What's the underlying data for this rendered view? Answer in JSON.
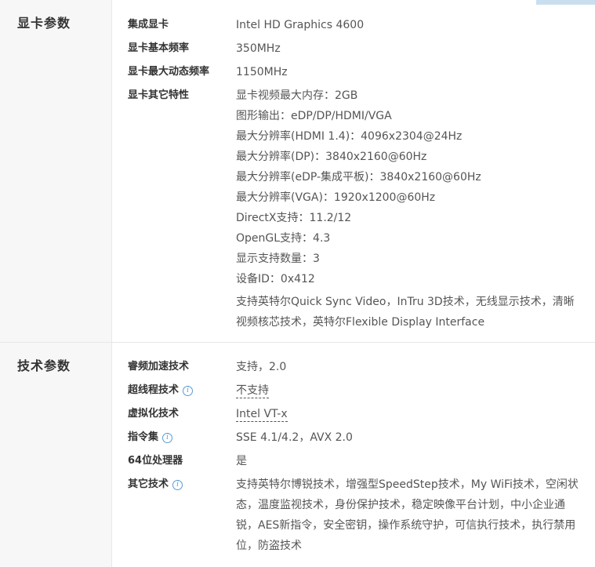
{
  "sections": [
    {
      "title": "显卡参数",
      "rows": [
        {
          "label": "集成显卡",
          "value": "Intel HD Graphics 4600"
        },
        {
          "label": "显卡基本频率",
          "value": "350MHz"
        },
        {
          "label": "显卡最大动态频率",
          "value": "1150MHz"
        },
        {
          "label": "显卡其它特性",
          "lines": [
            "显卡视频最大内存：2GB",
            "图形输出：eDP/DP/HDMI/VGA",
            "最大分辨率(HDMI 1.4)：4096x2304@24Hz",
            "最大分辨率(DP)：3840x2160@60Hz",
            "最大分辨率(eDP-集成平板)：3840x2160@60Hz",
            "最大分辨率(VGA)：1920x1200@60Hz",
            "DirectX支持：11.2/12",
            "OpenGL支持：4.3",
            "显示支持数量：3",
            "设备ID：0x412"
          ],
          "paragraph": "支持英特尔Quick Sync Video，InTru 3D技术，无线显示技术，清晰视频核芯技术，英特尔Flexible Display Interface"
        }
      ]
    },
    {
      "title": "技术参数",
      "rows": [
        {
          "label": "睿频加速技术",
          "value": "支持，2.0"
        },
        {
          "label": "超线程技术",
          "value": "不支持",
          "info_icon": "i"
        },
        {
          "label": "虚拟化技术",
          "value": "Intel VT-x"
        },
        {
          "label": "指令集",
          "value": "SSE 4.1/4.2，AVX 2.0",
          "info_icon": "i"
        },
        {
          "label": "64位处理器",
          "value": "是"
        },
        {
          "label": "其它技术",
          "info_icon": "i",
          "paragraph": "支持英特尔博锐技术，增强型SpeedStep技术，My WiFi技术，空闲状态，温度监视技术，身份保护技术，稳定映像平台计划，中小企业通锐，AES新指令，安全密钥，操作系统守护，可信执行技术，执行禁用位，防盗技术"
        }
      ]
    }
  ],
  "colors": {
    "label": "#333333",
    "value": "#555555",
    "section_bg": "#f7f7f7",
    "info_icon": "#5a9bd5",
    "top_accent": "#c9dff0"
  }
}
